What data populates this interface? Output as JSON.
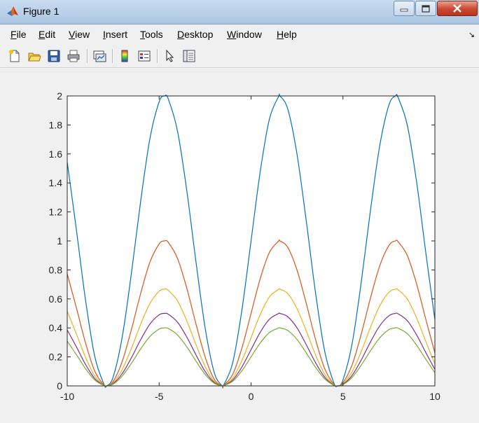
{
  "window": {
    "title": "Figure 1"
  },
  "menu": [
    "File",
    "Edit",
    "View",
    "Insert",
    "Tools",
    "Desktop",
    "Window",
    "Help"
  ],
  "toolbar": {
    "icons": [
      "new-figure-icon",
      "open-file-icon",
      "save-icon",
      "print-icon",
      "link-plot-icon",
      "insert-colorbar-icon",
      "insert-legend-icon",
      "pointer-icon",
      "property-inspector-icon"
    ]
  },
  "chart_data": {
    "type": "line",
    "title": "",
    "xlabel": "",
    "ylabel": "",
    "xlim": [
      -10,
      10
    ],
    "ylim": [
      0,
      2
    ],
    "xticks": [
      -10,
      -5,
      0,
      5,
      10
    ],
    "yticks": [
      0,
      0.2,
      0.4,
      0.6,
      0.8,
      1,
      1.2,
      1.4,
      1.6,
      1.8,
      2
    ],
    "xtick_labels": [
      "-10",
      "-5",
      "0",
      "5",
      "10"
    ],
    "ytick_labels": [
      "0",
      "0.2",
      "0.4",
      "0.6",
      "0.8",
      "1",
      "1.2",
      "1.4",
      "1.6",
      "1.8",
      "2"
    ],
    "grid": false,
    "legend": "none",
    "series": [
      {
        "color": "#0072bd",
        "x": [
          -10,
          -9.5,
          -9,
          -8.5,
          -8,
          -7.854,
          -7.5,
          -7,
          -6.5,
          -6,
          -5.5,
          -5,
          -4.712,
          -4.5,
          -4,
          -3.5,
          -3,
          -2.5,
          -2,
          -1.571,
          -1.5,
          -1,
          -0.5,
          0,
          0.5,
          1,
          1.5,
          1.571,
          2,
          2.5,
          3,
          3.5,
          4,
          4.5,
          4.712,
          5,
          5.5,
          6,
          6.5,
          7,
          7.5,
          7.854,
          8,
          8.5,
          9,
          9.5,
          10
        ],
        "y": [
          1.544,
          1.075,
          0.588,
          0.202,
          0.011,
          0,
          0.062,
          0.343,
          0.785,
          1.279,
          1.707,
          1.959,
          2,
          1.978,
          1.757,
          1.351,
          0.859,
          0.402,
          0.091,
          0,
          0.003,
          0.159,
          0.521,
          1,
          1.479,
          1.841,
          1.997,
          2,
          1.909,
          1.598,
          1.141,
          0.649,
          0.243,
          0.022,
          0,
          0.041,
          0.293,
          0.721,
          1.215,
          1.657,
          1.938,
          2,
          1.989,
          1.798,
          1.412,
          0.925,
          0.456
        ]
      },
      {
        "color": "#d95319",
        "x": [
          -10,
          -9.5,
          -9,
          -8.5,
          -8,
          -7.854,
          -7.5,
          -7,
          -6.5,
          -6,
          -5.5,
          -5,
          -4.712,
          -4.5,
          -4,
          -3.5,
          -3,
          -2.5,
          -2,
          -1.571,
          -1.5,
          -1,
          -0.5,
          0,
          0.5,
          1,
          1.5,
          1.571,
          2,
          2.5,
          3,
          3.5,
          4,
          4.5,
          4.712,
          5,
          5.5,
          6,
          6.5,
          7,
          7.5,
          7.854,
          8,
          8.5,
          9,
          9.5,
          10
        ],
        "y": [
          0.772,
          0.538,
          0.294,
          0.101,
          0.005,
          0,
          0.031,
          0.172,
          0.393,
          0.64,
          0.854,
          0.979,
          1,
          0.989,
          0.879,
          0.676,
          0.429,
          0.201,
          0.045,
          0,
          0.002,
          0.079,
          0.26,
          0.5,
          0.74,
          0.921,
          0.999,
          1,
          0.955,
          0.799,
          0.571,
          0.324,
          0.121,
          0.011,
          0,
          0.021,
          0.146,
          0.36,
          0.608,
          0.828,
          0.969,
          1,
          0.995,
          0.899,
          0.706,
          0.462,
          0.228
        ]
      },
      {
        "color": "#edb120",
        "x": [
          -10,
          -9.5,
          -9,
          -8.5,
          -8,
          -7.854,
          -7.5,
          -7,
          -6.5,
          -6,
          -5.5,
          -5,
          -4.712,
          -4.5,
          -4,
          -3.5,
          -3,
          -2.5,
          -2,
          -1.571,
          -1.5,
          -1,
          -0.5,
          0,
          0.5,
          1,
          1.5,
          1.571,
          2,
          2.5,
          3,
          3.5,
          4,
          4.5,
          4.712,
          5,
          5.5,
          6,
          6.5,
          7,
          7.5,
          7.854,
          8,
          8.5,
          9,
          9.5,
          10
        ],
        "y": [
          0.515,
          0.358,
          0.196,
          0.067,
          0.004,
          0,
          0.021,
          0.114,
          0.262,
          0.426,
          0.569,
          0.653,
          0.667,
          0.659,
          0.586,
          0.45,
          0.286,
          0.134,
          0.03,
          0,
          0.001,
          0.053,
          0.174,
          0.333,
          0.493,
          0.614,
          0.666,
          0.667,
          0.636,
          0.533,
          0.38,
          0.216,
          0.081,
          0.007,
          0,
          0.014,
          0.098,
          0.24,
          0.405,
          0.552,
          0.646,
          0.667,
          0.663,
          0.599,
          0.471,
          0.308,
          0.152
        ]
      },
      {
        "color": "#7e2f8e",
        "x": [
          -10,
          -9.5,
          -9,
          -8.5,
          -8,
          -7.854,
          -7.5,
          -7,
          -6.5,
          -6,
          -5.5,
          -5,
          -4.712,
          -4.5,
          -4,
          -3.5,
          -3,
          -2.5,
          -2,
          -1.571,
          -1.5,
          -1,
          -0.5,
          0,
          0.5,
          1,
          1.5,
          1.571,
          2,
          2.5,
          3,
          3.5,
          4,
          4.5,
          4.712,
          5,
          5.5,
          6,
          6.5,
          7,
          7.5,
          7.854,
          8,
          8.5,
          9,
          9.5,
          10
        ],
        "y": [
          0.386,
          0.269,
          0.147,
          0.05,
          0.003,
          0,
          0.016,
          0.086,
          0.196,
          0.32,
          0.427,
          0.49,
          0.5,
          0.494,
          0.439,
          0.338,
          0.215,
          0.1,
          0.023,
          0,
          0.001,
          0.04,
          0.13,
          0.25,
          0.37,
          0.46,
          0.499,
          0.5,
          0.477,
          0.4,
          0.285,
          0.162,
          0.061,
          0.005,
          0,
          0.01,
          0.073,
          0.18,
          0.304,
          0.414,
          0.484,
          0.5,
          0.497,
          0.45,
          0.353,
          0.231,
          0.114
        ]
      },
      {
        "color": "#77ac30",
        "x": [
          -10,
          -9.5,
          -9,
          -8.5,
          -8,
          -7.854,
          -7.5,
          -7,
          -6.5,
          -6,
          -5.5,
          -5,
          -4.712,
          -4.5,
          -4,
          -3.5,
          -3,
          -2.5,
          -2,
          -1.571,
          -1.5,
          -1,
          -0.5,
          0,
          0.5,
          1,
          1.5,
          1.571,
          2,
          2.5,
          3,
          3.5,
          4,
          4.5,
          4.712,
          5,
          5.5,
          6,
          6.5,
          7,
          7.5,
          7.854,
          8,
          8.5,
          9,
          9.5,
          10
        ],
        "y": [
          0.309,
          0.215,
          0.118,
          0.04,
          0.002,
          0,
          0.012,
          0.069,
          0.157,
          0.256,
          0.341,
          0.392,
          0.4,
          0.396,
          0.351,
          0.27,
          0.172,
          0.08,
          0.018,
          0,
          0.001,
          0.032,
          0.104,
          0.2,
          0.296,
          0.368,
          0.399,
          0.4,
          0.382,
          0.32,
          0.228,
          0.13,
          0.049,
          0.004,
          0,
          0.008,
          0.059,
          0.144,
          0.243,
          0.331,
          0.388,
          0.4,
          0.398,
          0.36,
          0.282,
          0.185,
          0.091
        ]
      }
    ]
  }
}
